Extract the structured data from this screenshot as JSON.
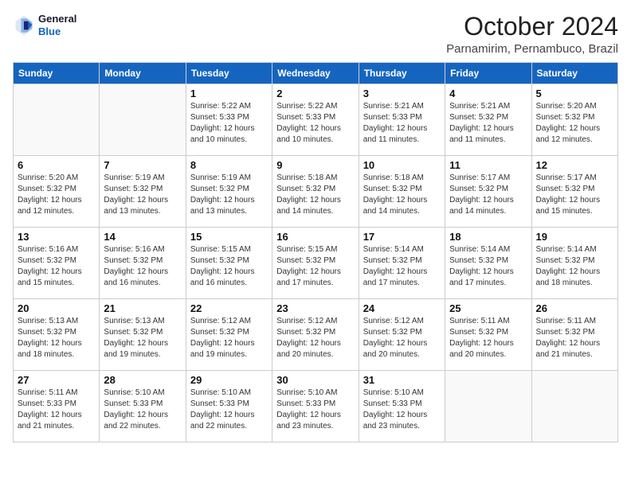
{
  "logo": {
    "line1": "General",
    "line2": "Blue"
  },
  "title": "October 2024",
  "location": "Parnamirim, Pernambuco, Brazil",
  "days_of_week": [
    "Sunday",
    "Monday",
    "Tuesday",
    "Wednesday",
    "Thursday",
    "Friday",
    "Saturday"
  ],
  "weeks": [
    [
      {
        "day": "",
        "sunrise": "",
        "sunset": "",
        "daylight": ""
      },
      {
        "day": "",
        "sunrise": "",
        "sunset": "",
        "daylight": ""
      },
      {
        "day": "1",
        "sunrise": "Sunrise: 5:22 AM",
        "sunset": "Sunset: 5:33 PM",
        "daylight": "Daylight: 12 hours and 10 minutes."
      },
      {
        "day": "2",
        "sunrise": "Sunrise: 5:22 AM",
        "sunset": "Sunset: 5:33 PM",
        "daylight": "Daylight: 12 hours and 10 minutes."
      },
      {
        "day": "3",
        "sunrise": "Sunrise: 5:21 AM",
        "sunset": "Sunset: 5:33 PM",
        "daylight": "Daylight: 12 hours and 11 minutes."
      },
      {
        "day": "4",
        "sunrise": "Sunrise: 5:21 AM",
        "sunset": "Sunset: 5:32 PM",
        "daylight": "Daylight: 12 hours and 11 minutes."
      },
      {
        "day": "5",
        "sunrise": "Sunrise: 5:20 AM",
        "sunset": "Sunset: 5:32 PM",
        "daylight": "Daylight: 12 hours and 12 minutes."
      }
    ],
    [
      {
        "day": "6",
        "sunrise": "Sunrise: 5:20 AM",
        "sunset": "Sunset: 5:32 PM",
        "daylight": "Daylight: 12 hours and 12 minutes."
      },
      {
        "day": "7",
        "sunrise": "Sunrise: 5:19 AM",
        "sunset": "Sunset: 5:32 PM",
        "daylight": "Daylight: 12 hours and 13 minutes."
      },
      {
        "day": "8",
        "sunrise": "Sunrise: 5:19 AM",
        "sunset": "Sunset: 5:32 PM",
        "daylight": "Daylight: 12 hours and 13 minutes."
      },
      {
        "day": "9",
        "sunrise": "Sunrise: 5:18 AM",
        "sunset": "Sunset: 5:32 PM",
        "daylight": "Daylight: 12 hours and 14 minutes."
      },
      {
        "day": "10",
        "sunrise": "Sunrise: 5:18 AM",
        "sunset": "Sunset: 5:32 PM",
        "daylight": "Daylight: 12 hours and 14 minutes."
      },
      {
        "day": "11",
        "sunrise": "Sunrise: 5:17 AM",
        "sunset": "Sunset: 5:32 PM",
        "daylight": "Daylight: 12 hours and 14 minutes."
      },
      {
        "day": "12",
        "sunrise": "Sunrise: 5:17 AM",
        "sunset": "Sunset: 5:32 PM",
        "daylight": "Daylight: 12 hours and 15 minutes."
      }
    ],
    [
      {
        "day": "13",
        "sunrise": "Sunrise: 5:16 AM",
        "sunset": "Sunset: 5:32 PM",
        "daylight": "Daylight: 12 hours and 15 minutes."
      },
      {
        "day": "14",
        "sunrise": "Sunrise: 5:16 AM",
        "sunset": "Sunset: 5:32 PM",
        "daylight": "Daylight: 12 hours and 16 minutes."
      },
      {
        "day": "15",
        "sunrise": "Sunrise: 5:15 AM",
        "sunset": "Sunset: 5:32 PM",
        "daylight": "Daylight: 12 hours and 16 minutes."
      },
      {
        "day": "16",
        "sunrise": "Sunrise: 5:15 AM",
        "sunset": "Sunset: 5:32 PM",
        "daylight": "Daylight: 12 hours and 17 minutes."
      },
      {
        "day": "17",
        "sunrise": "Sunrise: 5:14 AM",
        "sunset": "Sunset: 5:32 PM",
        "daylight": "Daylight: 12 hours and 17 minutes."
      },
      {
        "day": "18",
        "sunrise": "Sunrise: 5:14 AM",
        "sunset": "Sunset: 5:32 PM",
        "daylight": "Daylight: 12 hours and 17 minutes."
      },
      {
        "day": "19",
        "sunrise": "Sunrise: 5:14 AM",
        "sunset": "Sunset: 5:32 PM",
        "daylight": "Daylight: 12 hours and 18 minutes."
      }
    ],
    [
      {
        "day": "20",
        "sunrise": "Sunrise: 5:13 AM",
        "sunset": "Sunset: 5:32 PM",
        "daylight": "Daylight: 12 hours and 18 minutes."
      },
      {
        "day": "21",
        "sunrise": "Sunrise: 5:13 AM",
        "sunset": "Sunset: 5:32 PM",
        "daylight": "Daylight: 12 hours and 19 minutes."
      },
      {
        "day": "22",
        "sunrise": "Sunrise: 5:12 AM",
        "sunset": "Sunset: 5:32 PM",
        "daylight": "Daylight: 12 hours and 19 minutes."
      },
      {
        "day": "23",
        "sunrise": "Sunrise: 5:12 AM",
        "sunset": "Sunset: 5:32 PM",
        "daylight": "Daylight: 12 hours and 20 minutes."
      },
      {
        "day": "24",
        "sunrise": "Sunrise: 5:12 AM",
        "sunset": "Sunset: 5:32 PM",
        "daylight": "Daylight: 12 hours and 20 minutes."
      },
      {
        "day": "25",
        "sunrise": "Sunrise: 5:11 AM",
        "sunset": "Sunset: 5:32 PM",
        "daylight": "Daylight: 12 hours and 20 minutes."
      },
      {
        "day": "26",
        "sunrise": "Sunrise: 5:11 AM",
        "sunset": "Sunset: 5:32 PM",
        "daylight": "Daylight: 12 hours and 21 minutes."
      }
    ],
    [
      {
        "day": "27",
        "sunrise": "Sunrise: 5:11 AM",
        "sunset": "Sunset: 5:33 PM",
        "daylight": "Daylight: 12 hours and 21 minutes."
      },
      {
        "day": "28",
        "sunrise": "Sunrise: 5:10 AM",
        "sunset": "Sunset: 5:33 PM",
        "daylight": "Daylight: 12 hours and 22 minutes."
      },
      {
        "day": "29",
        "sunrise": "Sunrise: 5:10 AM",
        "sunset": "Sunset: 5:33 PM",
        "daylight": "Daylight: 12 hours and 22 minutes."
      },
      {
        "day": "30",
        "sunrise": "Sunrise: 5:10 AM",
        "sunset": "Sunset: 5:33 PM",
        "daylight": "Daylight: 12 hours and 23 minutes."
      },
      {
        "day": "31",
        "sunrise": "Sunrise: 5:10 AM",
        "sunset": "Sunset: 5:33 PM",
        "daylight": "Daylight: 12 hours and 23 minutes."
      },
      {
        "day": "",
        "sunrise": "",
        "sunset": "",
        "daylight": ""
      },
      {
        "day": "",
        "sunrise": "",
        "sunset": "",
        "daylight": ""
      }
    ]
  ]
}
